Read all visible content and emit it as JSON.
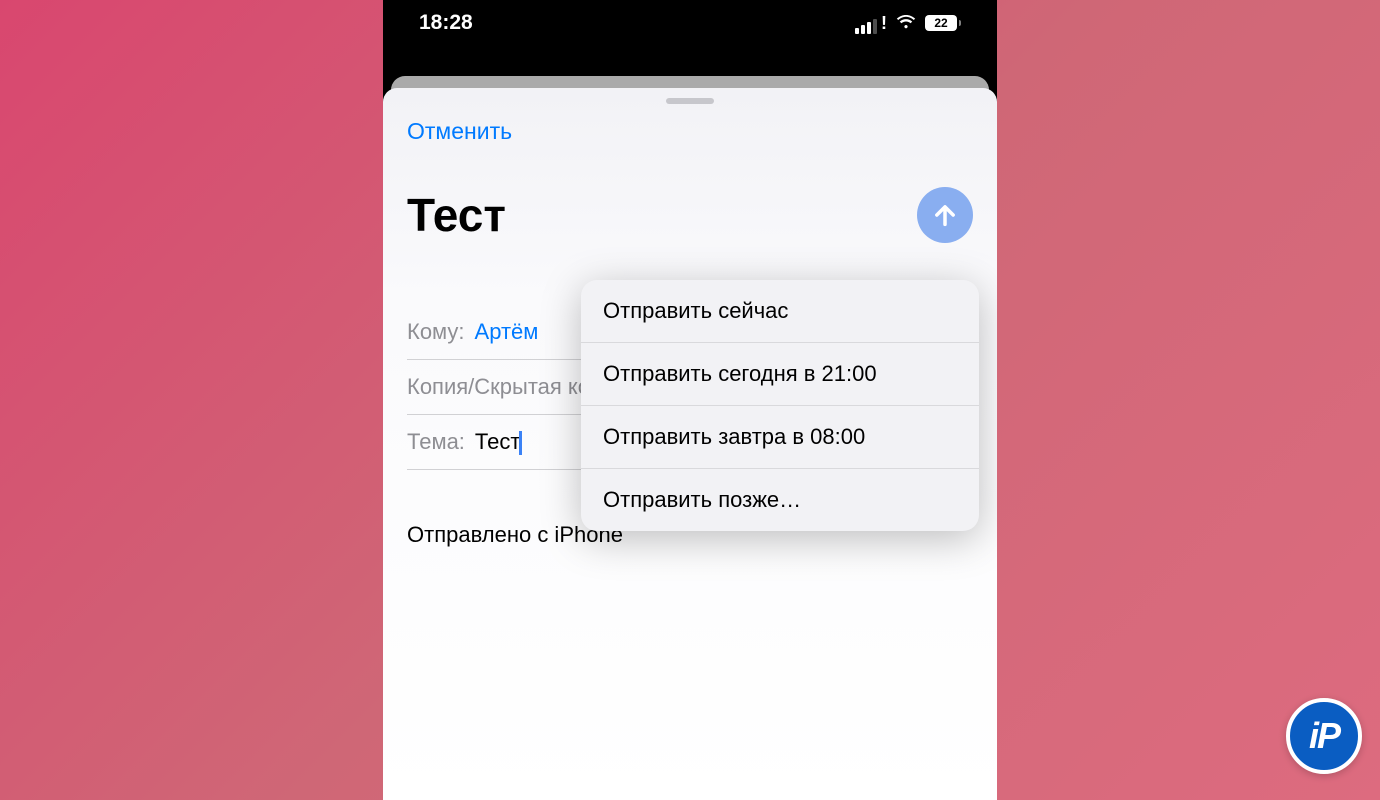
{
  "statusBar": {
    "time": "18:28",
    "batteryLevel": "22"
  },
  "compose": {
    "cancel": "Отменить",
    "subjectDisplay": "Тест",
    "toLabel": "Кому:",
    "toValue": "Артём",
    "ccBccLabel": "Копия/Скрытая копи",
    "subjectLabel": "Тема:",
    "subjectValue": "Тест",
    "signature": "Отправлено с iPhone"
  },
  "menu": {
    "items": [
      "Отправить сейчас",
      "Отправить сегодня в 21:00",
      "Отправить завтра в 08:00",
      "Отправить позже…"
    ]
  },
  "watermark": "iP"
}
